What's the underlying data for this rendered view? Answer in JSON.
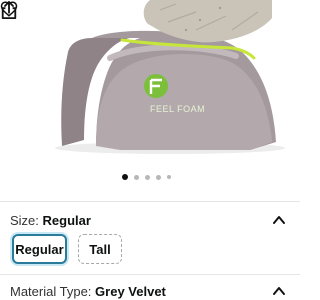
{
  "product_image": {
    "brand_logo_text": "FEEL FOAM",
    "carousel_dot_count": 5,
    "carousel_active_index": 0
  },
  "actions": {
    "wishlist_icon": "heart-icon",
    "share_icon": "share-icon"
  },
  "size": {
    "label": "Size:",
    "value": "Regular",
    "options": [
      {
        "label": "Regular",
        "selected": true
      },
      {
        "label": "Tall",
        "selected": false
      }
    ]
  },
  "material": {
    "label": "Material Type:",
    "value": "Grey Velvet"
  },
  "colors": {
    "selected_border": "#2a7a99",
    "pillow": "#9e9297",
    "stripe": "#c6e63a",
    "logo": "#7bbf3a"
  }
}
